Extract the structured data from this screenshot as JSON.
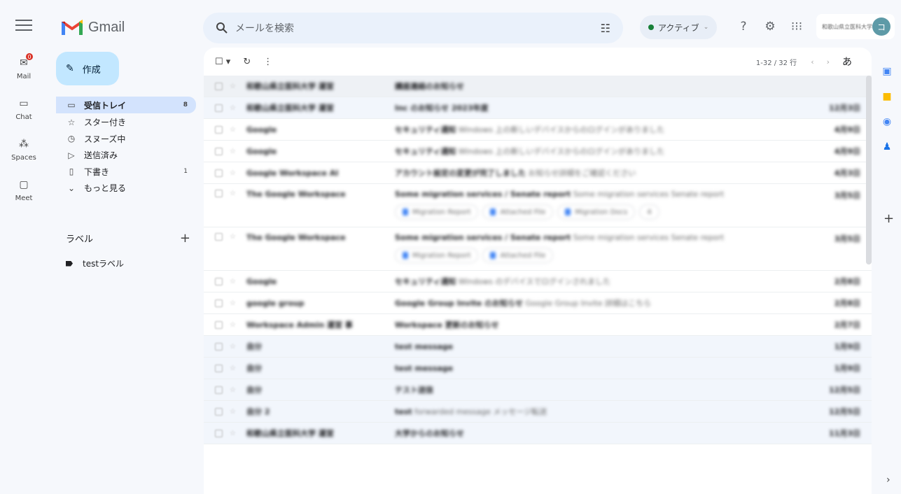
{
  "header": {
    "app_name": "Gmail",
    "search_placeholder": "メールを検索",
    "status_label": "アクティブ",
    "account_org": "和歌山県立医科大学",
    "avatar_initial": "コ",
    "colors": {
      "accent": "#c2e7ff",
      "active_nav": "#d3e3fd",
      "status_dot": "#188038"
    },
    "icons": [
      "menu-icon",
      "search-icon",
      "tune-icon",
      "help-icon",
      "settings-icon",
      "apps-icon"
    ]
  },
  "rail": [
    {
      "label": "Mail",
      "icon": "mail-icon",
      "badge": "0"
    },
    {
      "label": "Chat",
      "icon": "chat-icon"
    },
    {
      "label": "Spaces",
      "icon": "spaces-icon"
    },
    {
      "label": "Meet",
      "icon": "meet-icon"
    }
  ],
  "compose_label": "作成",
  "nav": [
    {
      "label": "受信トレイ",
      "count": "8",
      "icon": "inbox-icon",
      "glyph": "▭"
    },
    {
      "label": "スター付き",
      "count": "",
      "icon": "star-icon",
      "glyph": "☆"
    },
    {
      "label": "スヌーズ中",
      "count": "",
      "icon": "clock-icon",
      "glyph": "◷"
    },
    {
      "label": "送信済み",
      "count": "",
      "icon": "send-icon",
      "glyph": "▷"
    },
    {
      "label": "下書き",
      "count": "1",
      "icon": "draft-icon",
      "glyph": "▯"
    },
    {
      "label": "もっと見る",
      "count": "",
      "icon": "chevron-down-icon",
      "glyph": "⌄"
    }
  ],
  "labels_title": "ラベル",
  "label_items": [
    {
      "label": "testラベル"
    }
  ],
  "toolbar": {
    "pager": "1-32 / 32 行",
    "input_mode": "あ"
  },
  "emails": [
    {
      "sender": "和歌山県立医科大学 運営",
      "subject": "講座連絡のお知らせ",
      "snippet": "",
      "date": "",
      "kind": "hdr"
    },
    {
      "sender": "和歌山県立医科大学 運営",
      "subject": "Inc のお知らせ 2023年度",
      "snippet": "",
      "date": "12月3日",
      "kind": "read"
    },
    {
      "sender": "Google",
      "subject": "セキュリティ通知",
      "snippet": "Windows 上の新しいデバイスからのログインがありました",
      "date": "4月9日",
      "kind": "unread"
    },
    {
      "sender": "Google",
      "subject": "セキュリティ通知",
      "snippet": "Windows 上の新しいデバイスからのログインがありました",
      "date": "4月9日",
      "kind": "unread"
    },
    {
      "sender": "Google Workspace AI",
      "subject": "アカウント設定の変更が完了しました",
      "snippet": "お知らせ詳細をご確認ください",
      "date": "4月3日",
      "kind": "unread"
    },
    {
      "sender": "The Google Workspace",
      "subject": "Some migration services / Senate report",
      "snippet": "Some migration services Senate report",
      "date": "3月5日",
      "kind": "unread",
      "chips": [
        "Migration Report",
        "Attached File",
        "Migration Docs",
        "4"
      ]
    },
    {
      "sender": "The Google Workspace",
      "subject": "Some migration services / Senate report",
      "snippet": "Some migration services Senate report",
      "date": "3月5日",
      "kind": "unread",
      "chips": [
        "Migration Report",
        "Attached File"
      ]
    },
    {
      "sender": "Google",
      "subject": "セキュリティ通知",
      "snippet": "Windows のデバイスでログインされました",
      "date": "2月8日",
      "kind": "unread"
    },
    {
      "sender": "google group",
      "subject": "Google Group Invite のお知らせ",
      "snippet": "Google Group Invite 詳細はこちら",
      "date": "2月8日",
      "kind": "unread"
    },
    {
      "sender": "Workspace Admin 運営 事",
      "subject": "Workspace 更新のお知らせ",
      "snippet": "",
      "date": "2月7日",
      "kind": "unread"
    },
    {
      "sender": "自分",
      "subject": "test message",
      "snippet": "",
      "date": "1月9日",
      "kind": "read"
    },
    {
      "sender": "自分",
      "subject": "test message",
      "snippet": "",
      "date": "1月9日",
      "kind": "read"
    },
    {
      "sender": "自分",
      "subject": "テスト送信",
      "snippet": "",
      "date": "12月5日",
      "kind": "read"
    },
    {
      "sender": "自分 2",
      "subject": "test",
      "snippet": "forwarded message メッセージ転送",
      "date": "12月5日",
      "kind": "read"
    },
    {
      "sender": "和歌山県立医科大学 運営",
      "subject": "大学からのお知らせ",
      "snippet": "",
      "date": "11月3日",
      "kind": "read"
    }
  ]
}
